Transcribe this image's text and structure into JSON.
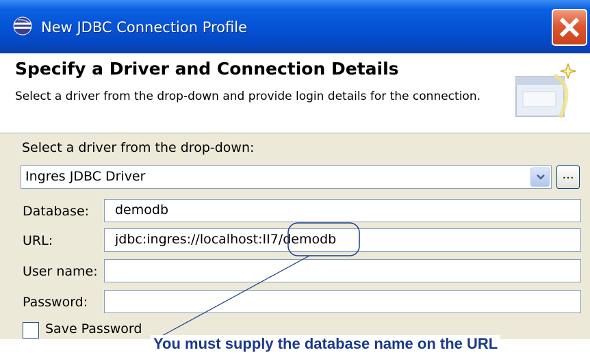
{
  "window": {
    "title": "New JDBC Connection Profile",
    "close_label": "Close"
  },
  "header": {
    "title": "Specify a Driver and Connection Details",
    "description": "Select a driver from the drop-down and provide login details for the connection."
  },
  "form": {
    "driver_prompt": "Select a driver from the drop-down:",
    "driver_selected": "Ingres JDBC Driver",
    "driver_browse_label": "...",
    "database_label": "Database:",
    "database_value": "demodb",
    "url_label": "URL:",
    "url_value": "jdbc:ingres://localhost:II7/demodb",
    "username_label": "User name:",
    "username_value": "",
    "password_label": "Password:",
    "password_value": "",
    "save_password_label": "Save Password",
    "save_password_checked": false
  },
  "annotation": {
    "callout": "You must supply the database name on the URL"
  },
  "colors": {
    "titlebar": "#0653d6",
    "dialog_bg": "#ece9d8",
    "callout_text": "#1a3a8a",
    "callout_outline": "#1a3a8a"
  }
}
